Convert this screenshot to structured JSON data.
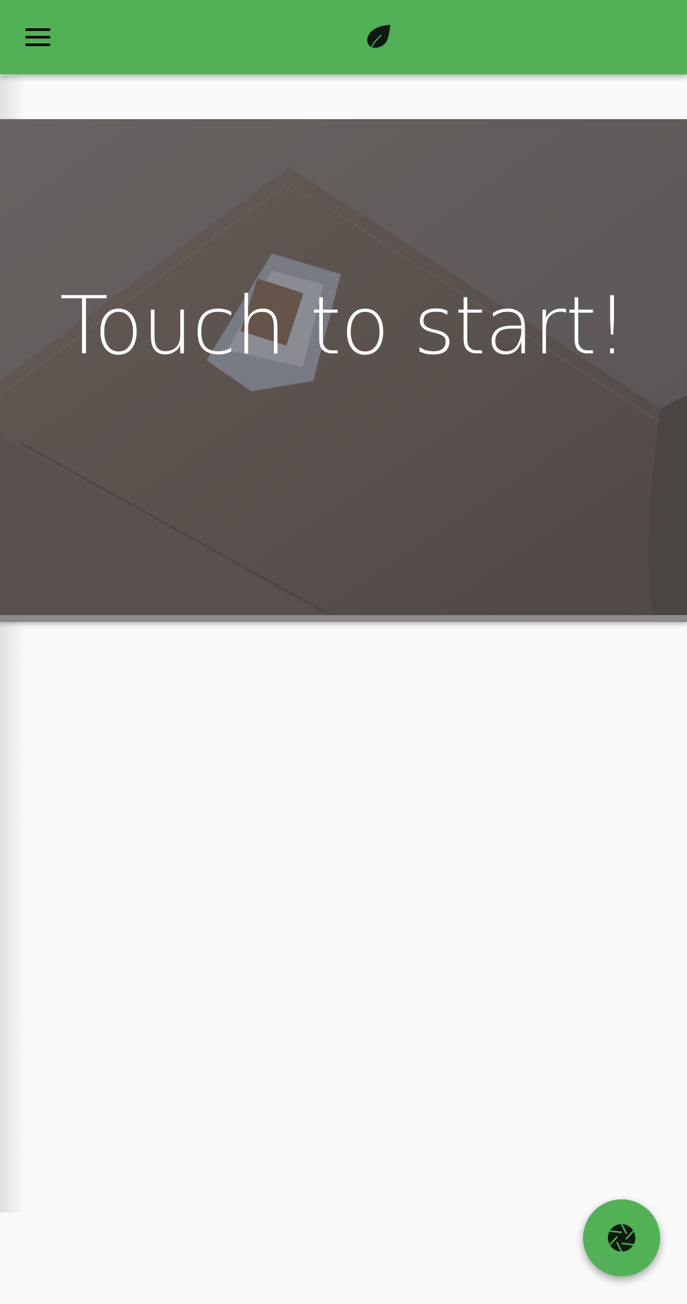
{
  "toolbar": {
    "color": "#52b156",
    "menu_icon": "hamburger-menu-icon",
    "logo_icon": "leaf-icon"
  },
  "camera_preview": {
    "prompt_text": "Touch to start!"
  },
  "fab": {
    "icon": "camera-shutter-icon",
    "color": "#52b156"
  }
}
